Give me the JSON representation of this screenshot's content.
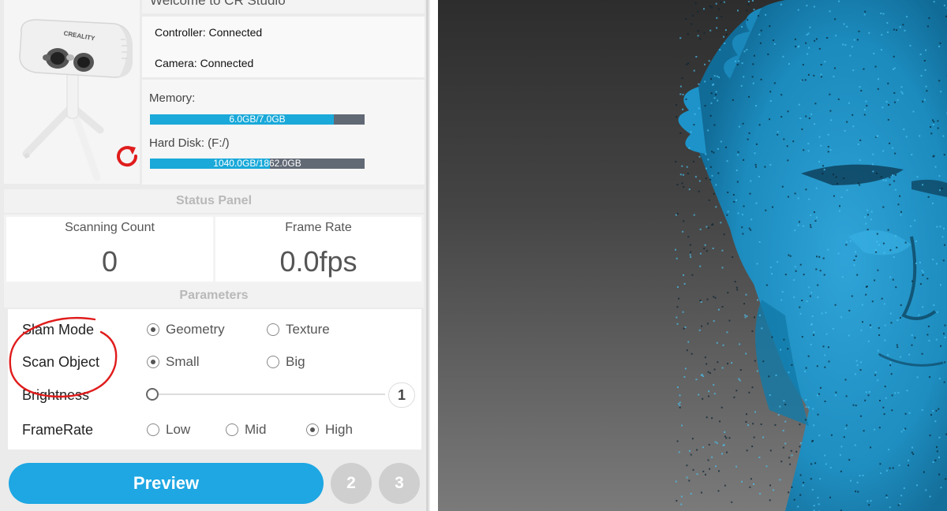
{
  "header": {
    "welcome": "Welcome to CR Studio"
  },
  "device": {
    "brand": "CREALITY"
  },
  "connection": {
    "controller": "Controller: Connected",
    "camera": "Camera: Connected"
  },
  "resources": {
    "memory_label": "Memory:",
    "memory_text": "6.0GB/7.0GB",
    "memory_fraction": 0.857,
    "disk_label": "Hard Disk: (F:/)",
    "disk_text": "1040.0GB/1862.0GB",
    "disk_fraction": 0.559
  },
  "status_panel": {
    "title": "Status Panel",
    "scanning_count_label": "Scanning Count",
    "scanning_count_value": "0",
    "frame_rate_label": "Frame Rate",
    "frame_rate_value": "0.0fps"
  },
  "parameters": {
    "title": "Parameters",
    "slam_mode_label": "Slam Mode",
    "slam_options": [
      "Geometry",
      "Texture"
    ],
    "slam_selected": "Geometry",
    "scan_object_label": "Scan Object",
    "scan_object_options": [
      "Small",
      "Big"
    ],
    "scan_object_selected": "Small",
    "brightness_label": "Brightness",
    "brightness_value": "1",
    "framerate_label": "FrameRate",
    "framerate_options": [
      "Low",
      "Mid",
      "High"
    ],
    "framerate_selected": "High"
  },
  "actions": {
    "preview": "Preview",
    "step2": "2",
    "step3": "3"
  },
  "colors": {
    "accent": "#1ea7e3",
    "annotation": "#e01c1c",
    "point_cloud": "#1a8fc4"
  }
}
